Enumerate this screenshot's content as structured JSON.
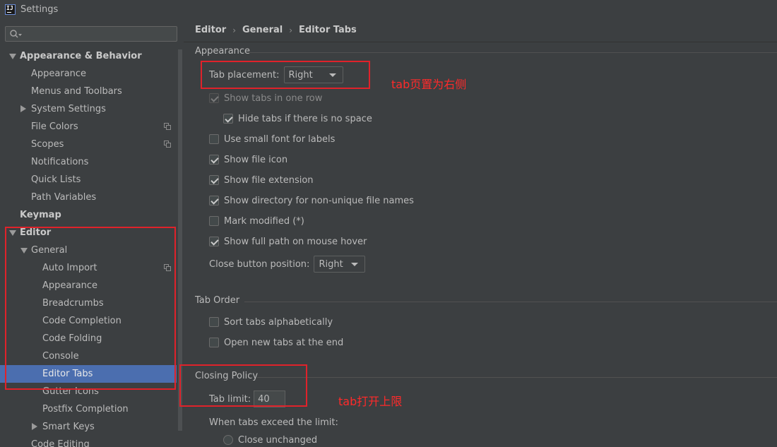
{
  "window": {
    "title": "Settings",
    "logo_text": "IJ"
  },
  "search": {
    "placeholder": "",
    "value": ""
  },
  "tree": [
    {
      "label": "Appearance & Behavior",
      "level": 0,
      "bold": true,
      "arrow": "down"
    },
    {
      "label": "Appearance",
      "level": 1
    },
    {
      "label": "Menus and Toolbars",
      "level": 1
    },
    {
      "label": "System Settings",
      "level": 1,
      "arrow": "right"
    },
    {
      "label": "File Colors",
      "level": 1,
      "copy": true
    },
    {
      "label": "Scopes",
      "level": 1,
      "copy": true
    },
    {
      "label": "Notifications",
      "level": 1
    },
    {
      "label": "Quick Lists",
      "level": 1
    },
    {
      "label": "Path Variables",
      "level": 1
    },
    {
      "label": "Keymap",
      "level": 0,
      "bold": true
    },
    {
      "label": "Editor",
      "level": 0,
      "bold": true,
      "arrow": "down"
    },
    {
      "label": "General",
      "level": 1,
      "arrow": "down"
    },
    {
      "label": "Auto Import",
      "level": 2,
      "copy": true
    },
    {
      "label": "Appearance",
      "level": 2
    },
    {
      "label": "Breadcrumbs",
      "level": 2
    },
    {
      "label": "Code Completion",
      "level": 2
    },
    {
      "label": "Code Folding",
      "level": 2
    },
    {
      "label": "Console",
      "level": 2
    },
    {
      "label": "Editor Tabs",
      "level": 2,
      "selected": true
    },
    {
      "label": "Gutter Icons",
      "level": 2
    },
    {
      "label": "Postfix Completion",
      "level": 2
    },
    {
      "label": "Smart Keys",
      "level": 2,
      "arrow": "right"
    },
    {
      "label": "Code Editing",
      "level": 1
    }
  ],
  "breadcrumb": [
    "Editor",
    "General",
    "Editor Tabs"
  ],
  "appearance": {
    "title": "Appearance",
    "tab_placement_label": "Tab placement:",
    "tab_placement_value": "Right",
    "options": [
      {
        "label": "Show tabs in one row",
        "checked": true,
        "disabled": true
      },
      {
        "label": "Hide tabs if there is no space",
        "checked": true
      },
      {
        "label": "Use small font for labels",
        "checked": false
      },
      {
        "label": "Show file icon",
        "checked": true
      },
      {
        "label": "Show file extension",
        "checked": true
      },
      {
        "label": "Show directory for non-unique file names",
        "checked": true
      },
      {
        "label": "Mark modified (*)",
        "checked": false
      },
      {
        "label": "Show full path on mouse hover",
        "checked": true
      }
    ],
    "close_button_label": "Close button position:",
    "close_button_value": "Right"
  },
  "tab_order": {
    "title": "Tab Order",
    "options": [
      {
        "label": "Sort tabs alphabetically",
        "checked": false
      },
      {
        "label": "Open new tabs at the end",
        "checked": false
      }
    ]
  },
  "closing_policy": {
    "title": "Closing Policy",
    "tab_limit_label": "Tab limit:",
    "tab_limit_value": "40",
    "exceed_label": "When tabs exceed the limit:",
    "radio_close_unchanged": "Close unchanged"
  },
  "annotations": {
    "placement_note": "tab页置为右侧",
    "limit_note": "tab打开上限",
    "color": "#e0222a"
  },
  "colors": {
    "background": "#3c3f41",
    "selection": "#4b6eaf",
    "text": "#bbbbbb"
  }
}
